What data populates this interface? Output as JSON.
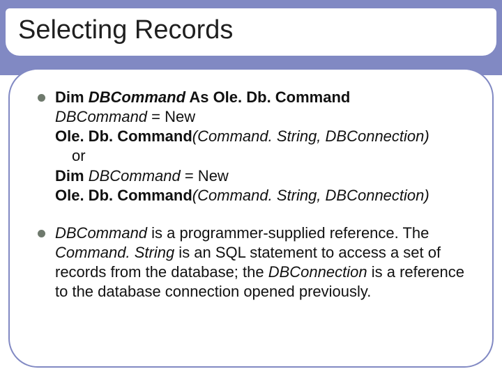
{
  "title": "Selecting Records",
  "bullet1": {
    "l1a": "Dim ",
    "l1b": "DBCommand",
    "l1c": " As Ole. Db. Command",
    "l2a": "DBCommand",
    "l2b": " = New",
    "l3a": "Ole. Db. Command",
    "l3b": "(Command. String, DBConnection)",
    "l4": "or",
    "l5a": "Dim ",
    "l5b": "DBCommand",
    "l5c": " = New",
    "l6a": "Ole. Db. Command",
    "l6b": "(Command. String, DBConnection)"
  },
  "bullet2": {
    "p1a": "DBCommand",
    "p1b": " is a programmer-supplied reference. The ",
    "p1c": "Command. String",
    "p1d": " is an SQL statement to access a set of records from the database; the ",
    "p1e": "DBConnection",
    "p1f": " is a reference to the database connection opened previously."
  }
}
